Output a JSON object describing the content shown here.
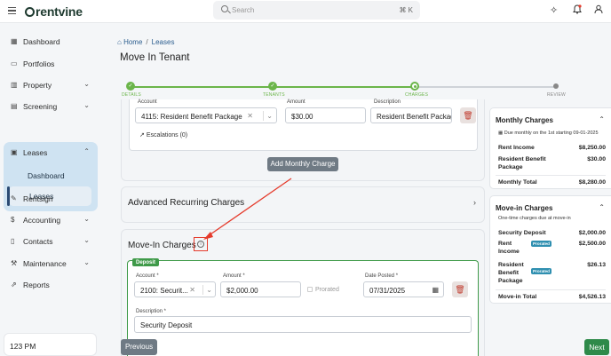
{
  "app": {
    "brand": "rentvine",
    "time": "123 PM"
  },
  "search": {
    "placeholder": "Search",
    "shortcut": "⌘ K"
  },
  "topbar_icons": [
    "sparkle-icon",
    "bell-icon",
    "user-icon"
  ],
  "sidebar": {
    "items": [
      {
        "label": "Dashboard",
        "icon": "grid-icon"
      },
      {
        "label": "Portfolios",
        "icon": "folder-icon"
      },
      {
        "label": "Property",
        "icon": "building-icon"
      },
      {
        "label": "Screening",
        "icon": "screening-icon"
      },
      {
        "label": "Leases",
        "icon": "lease-icon"
      },
      {
        "label": "Rentsign",
        "icon": "sign-icon"
      },
      {
        "label": "Accounting",
        "icon": "dollar-icon"
      },
      {
        "label": "Contacts",
        "icon": "contacts-icon"
      },
      {
        "label": "Maintenance",
        "icon": "wrench-icon"
      },
      {
        "label": "Reports",
        "icon": "reports-icon"
      }
    ],
    "lease_sub": [
      "Dashboard",
      "Leases"
    ]
  },
  "breadcrumb": {
    "home": "Home",
    "sep": "/",
    "current": "Leases"
  },
  "page_title": "Move In Tenant",
  "stepper": {
    "steps": [
      {
        "label": "DETAILS",
        "state": "done"
      },
      {
        "label": "TENANTS",
        "state": "done"
      },
      {
        "label": "CHARGES",
        "state": "current"
      },
      {
        "label": "REVIEW",
        "state": "todo"
      }
    ]
  },
  "monthly_charge": {
    "account_label": "Account",
    "amount_label": "Amount",
    "description_label": "Description",
    "account": "4115: Resident Benefit Package",
    "amount": "$30.00",
    "description": "Resident Benefit Package",
    "escalations": "Escalations (0)",
    "add_button": "Add Monthly Charge"
  },
  "advanced": {
    "title": "Advanced Recurring Charges"
  },
  "movein": {
    "title": "Move-In Charges",
    "deposit_tag": "Deposit",
    "account_label": "Account *",
    "amount_label": "Amount *",
    "date_label": "Date Posted *",
    "account": "2100: Securit...",
    "amount": "$2,000.00",
    "prorated": "Prorated",
    "date": "07/31/2025",
    "description_label": "Description *",
    "description": "Security Deposit"
  },
  "buttons": {
    "previous": "Previous",
    "next": "Next"
  },
  "monthly_panel": {
    "title": "Monthly Charges",
    "due_note": "Due monthly on the 1st starting 09-01-2025",
    "rows": [
      {
        "label": "Rent Income",
        "value": "$8,250.00"
      },
      {
        "label": "Resident Benefit Package",
        "value": "$30.00"
      }
    ],
    "total_label": "Monthly Total",
    "total_value": "$8,280.00"
  },
  "movein_panel": {
    "title": "Move-in Charges",
    "note": "One-time charges due at move-in",
    "rows": [
      {
        "label": "Security Deposit",
        "value": "$2,000.00",
        "badge": ""
      },
      {
        "label": "Rent Income",
        "value": "$2,500.00",
        "badge": "Prorated"
      },
      {
        "label": "Resident Benefit Package",
        "value": "$26.13",
        "badge": "Prorated"
      }
    ],
    "total_label": "Move-in Total",
    "total_value": "$4,526.13"
  },
  "colors": {
    "brand": "#1e3a2f",
    "accent_green": "#6bb54a",
    "button_green": "#2e8a4a",
    "annotation_red": "#e53b2c"
  }
}
